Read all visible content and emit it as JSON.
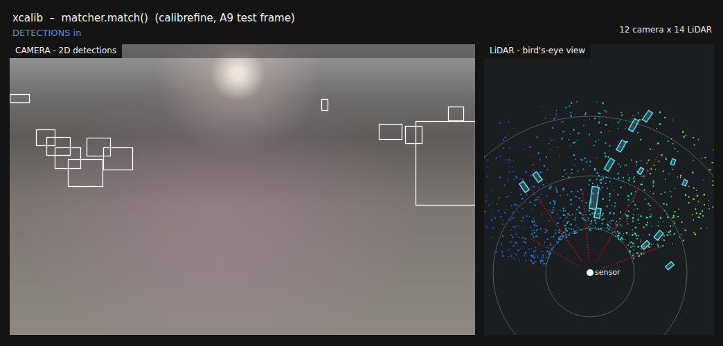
{
  "window": {
    "title": "xcalib  –  matcher.match()  (calibrefine, A9 test frame)",
    "subtitle": "DETECTIONS in",
    "counts": "12 camera x 14 LiDAR"
  },
  "camera_panel": {
    "label": "CAMERA - 2D detections"
  },
  "lidar_panel": {
    "label": "LiDAR - bird's-eye view",
    "sensor_label": "sensor"
  }
}
